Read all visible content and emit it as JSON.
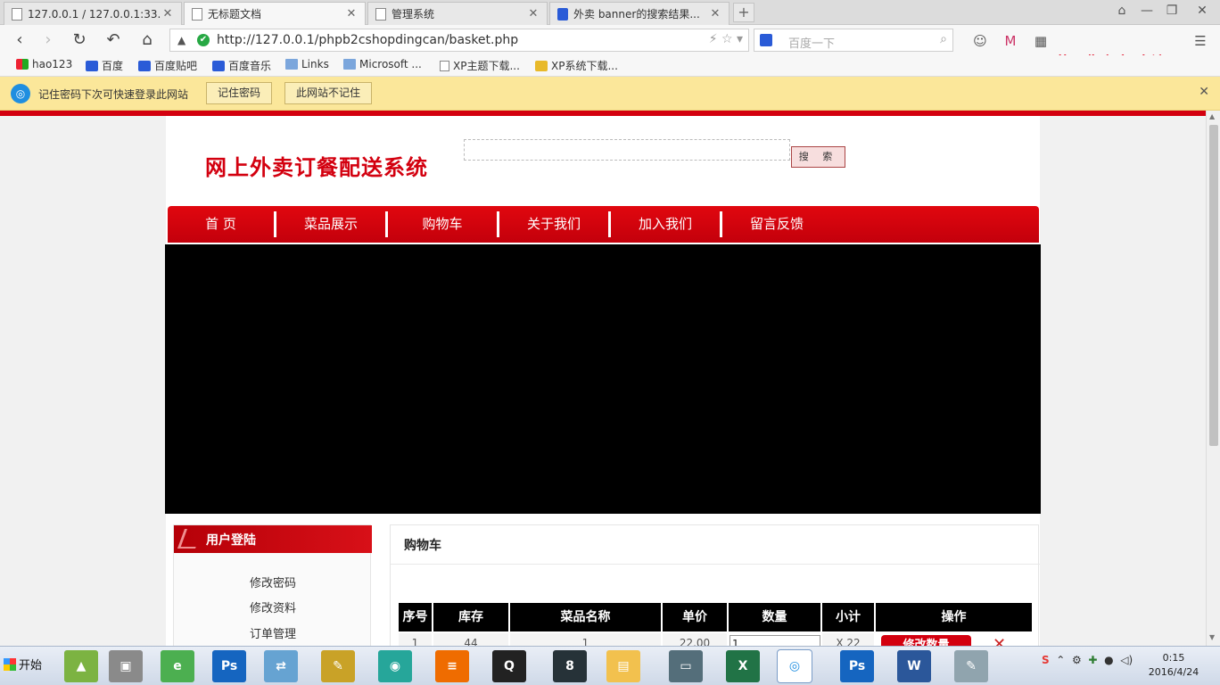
{
  "browser": {
    "tabs": [
      {
        "title": "127.0.0.1 / 127.0.0.1:33...",
        "active": false
      },
      {
        "title": "无标题文档",
        "active": true
      },
      {
        "title": "管理系统",
        "active": false
      },
      {
        "title": "外卖 banner的搜索结果...",
        "active": false
      }
    ],
    "address": "http://127.0.0.1/phpb2cshopdingcan/basket.php",
    "search_placeholder": "百度一下",
    "watermark": "屏幕录像专家 未注册",
    "bookmarks": [
      {
        "label": "hao123",
        "icon": "hao123-icon"
      },
      {
        "label": "百度",
        "icon": "baidu-icon"
      },
      {
        "label": "百度贴吧",
        "icon": "baidu-icon"
      },
      {
        "label": "百度音乐",
        "icon": "baidu-icon"
      },
      {
        "label": "Links",
        "icon": "folder-icon"
      },
      {
        "label": "Microsoft ...",
        "icon": "folder-icon"
      },
      {
        "label": "XP主题下载...",
        "icon": "page-icon"
      },
      {
        "label": "XP系统下载...",
        "icon": "xp-icon"
      }
    ],
    "password_bar": {
      "message": "记住密码下次可快速登录此网站",
      "remember": "记住密码",
      "never": "此网站不记住"
    }
  },
  "site": {
    "logo": "网上外卖订餐配送系统",
    "search_button": "搜 索",
    "nav": [
      "首  页",
      "菜品展示",
      "购物车",
      "关于我们",
      "加入我们",
      "留言反馈"
    ],
    "user_panel": {
      "title": "用户登陆",
      "links": [
        "修改密码",
        "修改资料",
        "订单管理"
      ]
    },
    "cart": {
      "title": "购物车",
      "columns": [
        "序号",
        "库存",
        "菜品名称",
        "单价",
        "数量",
        "小计",
        "操作"
      ],
      "row": {
        "index": "1",
        "stock": "44",
        "name": "1",
        "price": "22.00",
        "qty": "1",
        "subtotal": "X  22",
        "edit": "修改数量",
        "delete": "✕"
      }
    }
  },
  "taskbar": {
    "start": "开始",
    "clock_time": "0:15",
    "clock_date": "2016/4/24"
  }
}
